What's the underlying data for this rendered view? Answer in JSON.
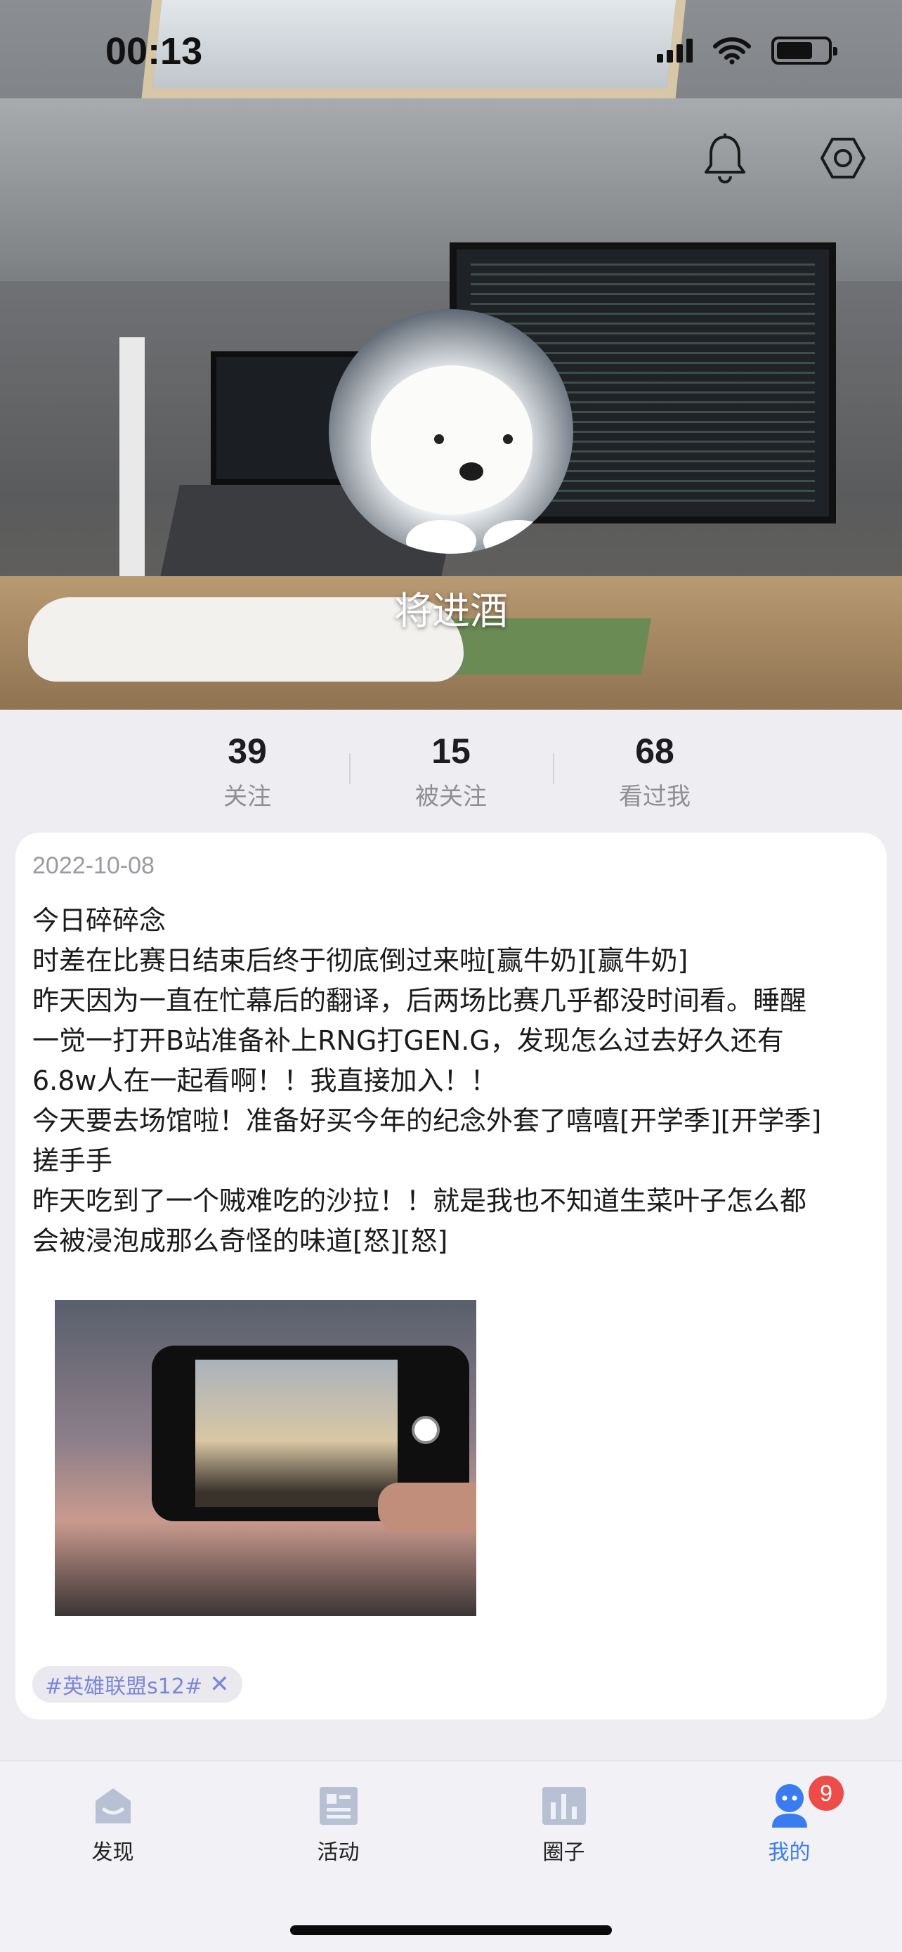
{
  "status_bar": {
    "time": "00:13"
  },
  "profile": {
    "nickname": "将进酒",
    "stats": [
      {
        "value": "39",
        "label": "关注"
      },
      {
        "value": "15",
        "label": "被关注"
      },
      {
        "value": "68",
        "label": "看过我"
      }
    ]
  },
  "post": {
    "date": "2022-10-08",
    "content": "今日碎碎念\n时差在比赛日结束后终于彻底倒过来啦[赢牛奶][赢牛奶]\n昨天因为一直在忙幕后的翻译，后两场比赛几乎都没时间看。睡醒\n一觉一打开B站准备补上RNG打GEN.G，发现怎么过去好久还有\n6.8w人在一起看啊！！我直接加入！！\n今天要去场馆啦！准备好买今年的纪念外套了嘻嘻[开学季][开学季]\n搓手手\n昨天吃到了一个贼难吃的沙拉！！就是我也不知道生菜叶子怎么都\n会被浸泡成那么奇怪的味道[怒][怒]",
    "tag": "#英雄联盟s12#"
  },
  "tabs": [
    {
      "label": "发现",
      "icon": "home-icon"
    },
    {
      "label": "活动",
      "icon": "activity-icon"
    },
    {
      "label": "圈子",
      "icon": "circle-chart-icon"
    },
    {
      "label": "我的",
      "icon": "profile-icon",
      "badge": "9"
    }
  ],
  "colors": {
    "accent": "#3a7cf0",
    "badge": "#ee4b4b",
    "tag_text": "#7c86d6",
    "icon_inactive": "#b8c1d4"
  }
}
